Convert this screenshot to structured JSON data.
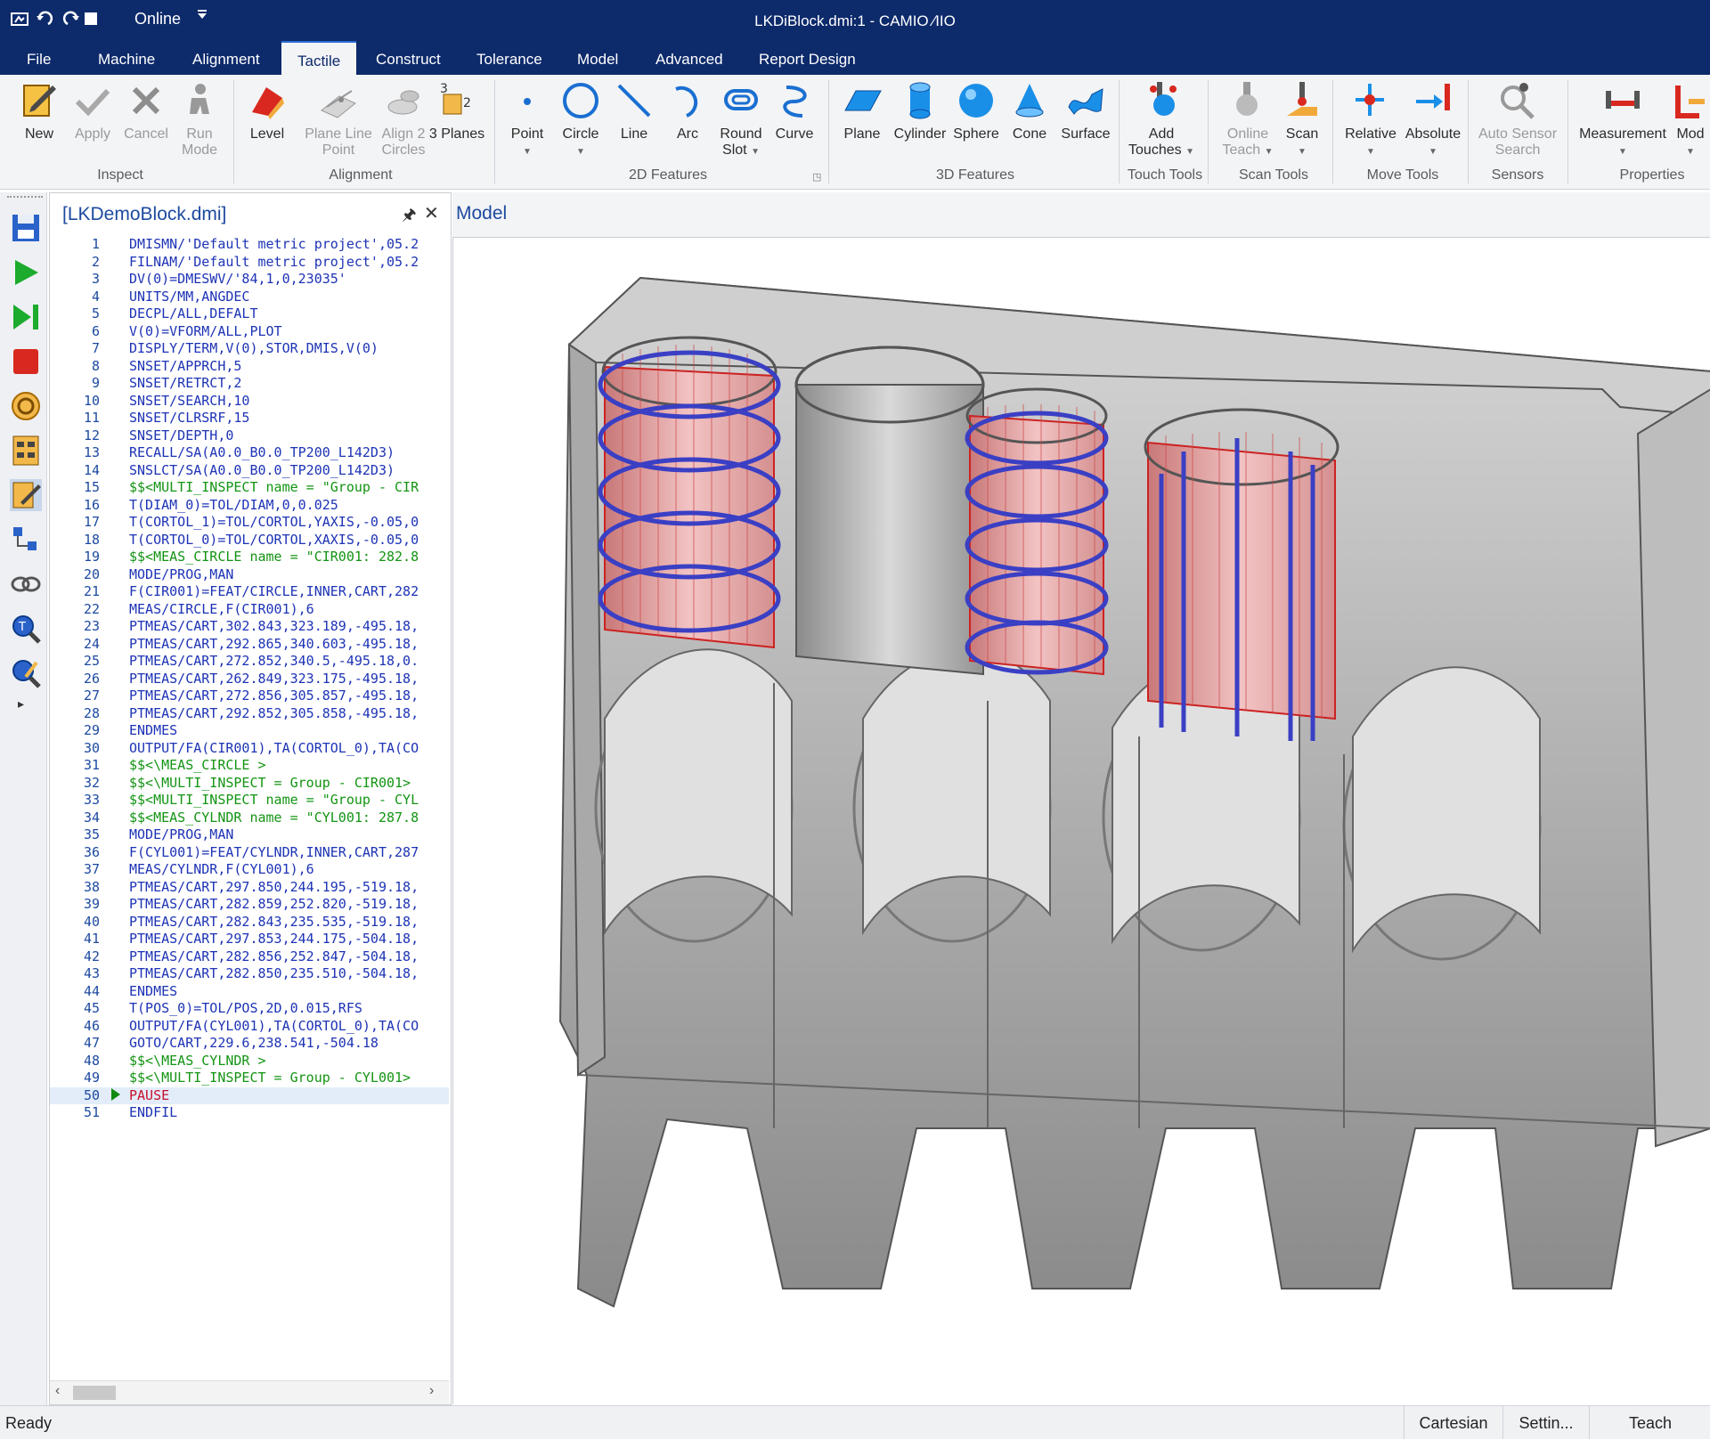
{
  "titlebar": {
    "mode": "Online",
    "title": "LKDiBlock.dmi:1 - CAMIO ∕IIO",
    "bg": "#0d2a6b"
  },
  "menu": [
    "File",
    "Machine",
    "Alignment",
    "Tactile",
    "Construct",
    "Tolerance",
    "Model",
    "Advanced",
    "Report Design"
  ],
  "menu_active": "Tactile",
  "ribbon": {
    "buttons": {
      "new": "New",
      "apply": "Apply",
      "cancel": "Cancel",
      "run": "Run",
      "mode": "Mode",
      "level": "Level",
      "plane_line": "Plane Line",
      "point_sub": "Point",
      "align2": "Align 2",
      "circles": "Circles",
      "three_planes": "3 Planes",
      "point": "Point",
      "circle": "Circle",
      "line": "Line",
      "arc": "Arc",
      "round": "Round",
      "slot": "Slot",
      "curve": "Curve",
      "plane": "Plane",
      "cylinder": "Cylinder",
      "sphere": "Sphere",
      "cone": "Cone",
      "surface": "Surface",
      "add": "Add",
      "touches": "Touches",
      "online": "Online",
      "teach": "Teach",
      "scan": "Scan",
      "relative": "Relative",
      "absolute": "Absolute",
      "auto_sensor": "Auto Sensor",
      "search": "Search",
      "measurement": "Measurement",
      "mod": "Mod"
    },
    "groups": {
      "inspect": "Inspect",
      "alignment": "Alignment",
      "features2d": "2D Features",
      "features3d": "3D Features",
      "touch_tools": "Touch Tools",
      "scan_tools": "Scan Tools",
      "move_tools": "Move Tools",
      "sensors": "Sensors",
      "properties": "Properties"
    }
  },
  "code_panel": {
    "title": "[LKDemoBlock.dmi]",
    "current_line": 50,
    "lines": [
      {
        "n": "1",
        "t": "DMISMN/'Default metric project',05.2",
        "k": "code"
      },
      {
        "n": "2",
        "t": "FILNAM/'Default metric project',05.2",
        "k": "code"
      },
      {
        "n": "3",
        "t": "DV(0)=DMESWV/'84,1,0,23035'",
        "k": "code"
      },
      {
        "n": "4",
        "t": "UNITS/MM,ANGDEC",
        "k": "code"
      },
      {
        "n": "5",
        "t": "DECPL/ALL,DEFALT",
        "k": "code"
      },
      {
        "n": "6",
        "t": "V(0)=VFORM/ALL,PLOT",
        "k": "code"
      },
      {
        "n": "7",
        "t": "DISPLY/TERM,V(0),STOR,DMIS,V(0)",
        "k": "code"
      },
      {
        "n": "8",
        "t": "SNSET/APPRCH,5",
        "k": "code"
      },
      {
        "n": "9",
        "t": "SNSET/RETRCT,2",
        "k": "code"
      },
      {
        "n": "10",
        "t": "SNSET/SEARCH,10",
        "k": "code"
      },
      {
        "n": "11",
        "t": "SNSET/CLRSRF,15",
        "k": "code"
      },
      {
        "n": "12",
        "t": "SNSET/DEPTH,0",
        "k": "code"
      },
      {
        "n": "13",
        "t": "RECALL/SA(A0.0_B0.0_TP200_L142D3)",
        "k": "code"
      },
      {
        "n": "14",
        "t": "SNSLCT/SA(A0.0_B0.0_TP200_L142D3)",
        "k": "code"
      },
      {
        "n": "15",
        "t": "$$<MULTI_INSPECT name = \"Group - CIR",
        "k": "cmt"
      },
      {
        "n": "16",
        "t": "T(DIAM_0)=TOL/DIAM,0,0.025",
        "k": "code"
      },
      {
        "n": "17",
        "t": "T(CORTOL_1)=TOL/CORTOL,YAXIS,-0.05,0",
        "k": "code"
      },
      {
        "n": "18",
        "t": "T(CORTOL_0)=TOL/CORTOL,XAXIS,-0.05,0",
        "k": "code"
      },
      {
        "n": "19",
        "t": "$$<MEAS_CIRCLE name = \"CIR001: 282.8",
        "k": "cmt"
      },
      {
        "n": "20",
        "t": "MODE/PROG,MAN",
        "k": "code"
      },
      {
        "n": "21",
        "t": "F(CIR001)=FEAT/CIRCLE,INNER,CART,282",
        "k": "code"
      },
      {
        "n": "22",
        "t": "MEAS/CIRCLE,F(CIR001),6",
        "k": "code"
      },
      {
        "n": "23",
        "t": "PTMEAS/CART,302.843,323.189,-495.18,",
        "k": "code"
      },
      {
        "n": "24",
        "t": "PTMEAS/CART,292.865,340.603,-495.18,",
        "k": "code"
      },
      {
        "n": "25",
        "t": "PTMEAS/CART,272.852,340.5,-495.18,0.",
        "k": "code"
      },
      {
        "n": "26",
        "t": "PTMEAS/CART,262.849,323.175,-495.18,",
        "k": "code"
      },
      {
        "n": "27",
        "t": "PTMEAS/CART,272.856,305.857,-495.18,",
        "k": "code"
      },
      {
        "n": "28",
        "t": "PTMEAS/CART,292.852,305.858,-495.18,",
        "k": "code"
      },
      {
        "n": "29",
        "t": "ENDMES",
        "k": "code"
      },
      {
        "n": "30",
        "t": "OUTPUT/FA(CIR001),TA(CORTOL_0),TA(CO",
        "k": "code"
      },
      {
        "n": "31",
        "t": "$$<\\MEAS_CIRCLE >",
        "k": "cmt"
      },
      {
        "n": "32",
        "t": "$$<\\MULTI_INSPECT = Group - CIR001>",
        "k": "cmt"
      },
      {
        "n": "33",
        "t": "$$<MULTI_INSPECT name = \"Group - CYL",
        "k": "cmt"
      },
      {
        "n": "34",
        "t": "$$<MEAS_CYLNDR name = \"CYL001: 287.8",
        "k": "cmt"
      },
      {
        "n": "35",
        "t": "MODE/PROG,MAN",
        "k": "code"
      },
      {
        "n": "36",
        "t": "F(CYL001)=FEAT/CYLNDR,INNER,CART,287",
        "k": "code"
      },
      {
        "n": "37",
        "t": "MEAS/CYLNDR,F(CYL001),6",
        "k": "code"
      },
      {
        "n": "38",
        "t": "PTMEAS/CART,297.850,244.195,-519.18,",
        "k": "code"
      },
      {
        "n": "39",
        "t": "PTMEAS/CART,282.859,252.820,-519.18,",
        "k": "code"
      },
      {
        "n": "40",
        "t": "PTMEAS/CART,282.843,235.535,-519.18,",
        "k": "code"
      },
      {
        "n": "41",
        "t": "PTMEAS/CART,297.853,244.175,-504.18,",
        "k": "code"
      },
      {
        "n": "42",
        "t": "PTMEAS/CART,282.856,252.847,-504.18,",
        "k": "code"
      },
      {
        "n": "43",
        "t": "PTMEAS/CART,282.850,235.510,-504.18,",
        "k": "code"
      },
      {
        "n": "44",
        "t": "ENDMES",
        "k": "code"
      },
      {
        "n": "45",
        "t": "T(POS_0)=TOL/POS,2D,0.015,RFS",
        "k": "code"
      },
      {
        "n": "46",
        "t": "OUTPUT/FA(CYL001),TA(CORTOL_0),TA(CO",
        "k": "code"
      },
      {
        "n": "47",
        "t": "GOTO/CART,229.6,238.541,-504.18",
        "k": "code"
      },
      {
        "n": "48",
        "t": "$$<\\MEAS_CYLNDR >",
        "k": "cmt"
      },
      {
        "n": "49",
        "t": "$$<\\MULTI_INSPECT = Group - CYL001>",
        "k": "cmt"
      },
      {
        "n": "50",
        "t": "PAUSE",
        "k": "pause"
      },
      {
        "n": "51",
        "t": "ENDFIL",
        "k": "code"
      }
    ]
  },
  "model_panel": {
    "title": "Model"
  },
  "statusbar": {
    "status": "Ready",
    "coord": "Cartesian",
    "settings": "Settin...",
    "teach": "Teach"
  },
  "colors": {
    "accent": "#1d4aa0",
    "code": "#1d33b5",
    "comment": "#139413",
    "pause": "#c8102e",
    "scan_path": "#3a3fc4",
    "bore_highlight": "#e6a8a8"
  }
}
